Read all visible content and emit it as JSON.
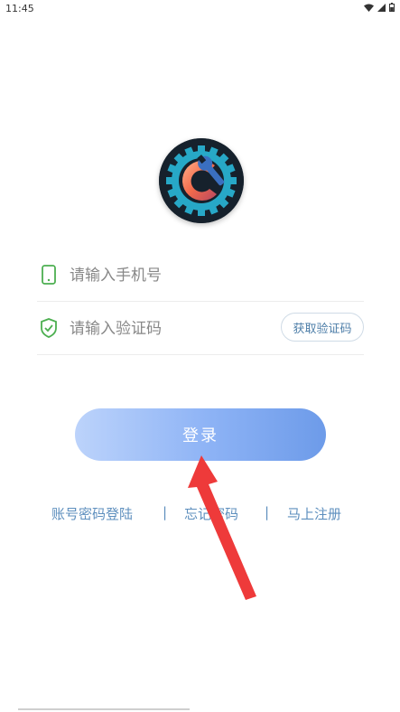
{
  "status_bar": {
    "time": "11:45",
    "icons": [
      "wifi-icon",
      "signal-icon",
      "battery-icon"
    ]
  },
  "logo": {
    "icon": "gear-wrench-logo"
  },
  "phone_field": {
    "placeholder": "请输入手机号",
    "icon": "phone-icon"
  },
  "code_field": {
    "placeholder": "请输入验证码",
    "icon": "shield-check-icon",
    "get_code_label": "获取验证码"
  },
  "login": {
    "label": "登录"
  },
  "links": {
    "account_login": "账号密码登陆",
    "separator": "|",
    "forgot_password": "忘记密码",
    "register": "马上注册"
  },
  "colors": {
    "accent_green": "#4caf50",
    "link_blue": "#5e8fbe",
    "button_gradient_start": "#bcd3fb",
    "button_gradient_end": "#6d9be9",
    "annotation_red": "#ee3a3a"
  }
}
